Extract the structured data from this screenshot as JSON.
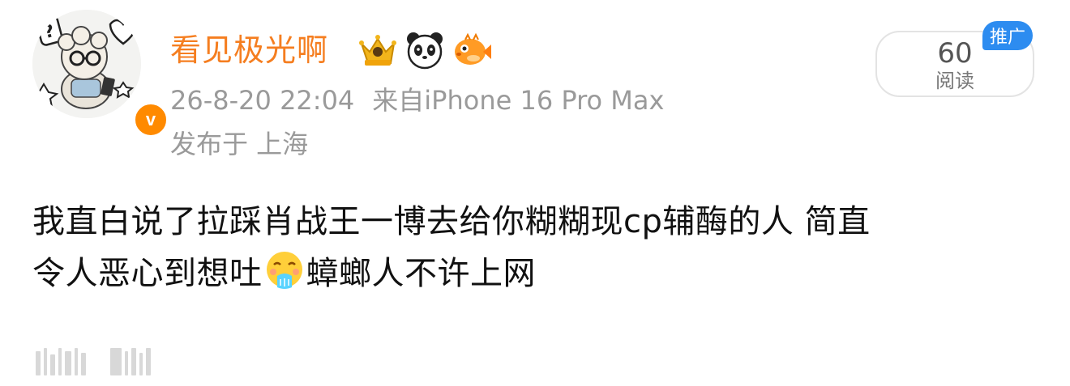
{
  "user": {
    "name": "看见极光啊",
    "avatar_icon": "cartoon-sheep-avatar-icon",
    "verified_icon": "verified-v-badge-icon",
    "verified_letter": "v",
    "badges": [
      "crown-badge-icon",
      "panda-badge-icon",
      "pufferfish-badge-icon"
    ]
  },
  "meta": {
    "date": "26-8-20 22:04",
    "source": "来自iPhone 16 Pro Max",
    "location": "发布于 上海"
  },
  "stats": {
    "read_count": "60",
    "read_label": "阅读",
    "promo_label": "推广"
  },
  "post": {
    "line1": "我直白说了拉踩肖战王一博去给你糊糊现cp辅酶的人  简直",
    "line2_before_emoji": "令人恶心到想吐",
    "emoji_icon": "vomit-face-emoji-icon",
    "line2_after_emoji": "蟑螂人不许上网"
  },
  "colors": {
    "username": "#f57e20",
    "meta_text": "#9a9a9a",
    "body_text": "#111111",
    "verified_badge": "#ff8a00",
    "promo_tag": "#2d8cf0"
  }
}
